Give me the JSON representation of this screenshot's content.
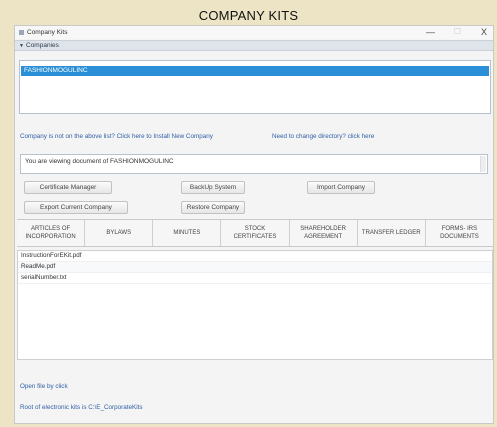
{
  "caption": "COMPANY KITS",
  "window": {
    "title": "Company Kits",
    "minimize": "—",
    "maximize": "☐",
    "close": "X"
  },
  "section": {
    "label": "Companies"
  },
  "companies": [
    "FASHIONMOGULINC"
  ],
  "links": {
    "install": "Company is not on the above list? Click here to Install New Company",
    "change_dir": "Need to change directory? click here"
  },
  "document_status": "You are viewing document of FASHIONMOGULINC",
  "buttons": {
    "certificate_manager": "Certificate Manager",
    "backup_system": "BackUp System",
    "import_company": "Import Company",
    "export_current": "Export Current Company",
    "restore_company": "Restore Company"
  },
  "tabs": [
    "ARTICLES OF INCORPORATION",
    "BYLAWS",
    "MINUTES",
    "STOCK CERTIFICATES",
    "SHAREHOLDER AGREEMENT",
    "TRANSFER LEDGER",
    "FORMS- IRS DOCUMENTS"
  ],
  "files": [
    "InstructionForEKit.pdf",
    "ReadMe.pdf",
    "serialNumber.txt"
  ],
  "open_hint": "Open file by click",
  "root_text": "Root of electronic kits is C:\\E_CorporateKits"
}
